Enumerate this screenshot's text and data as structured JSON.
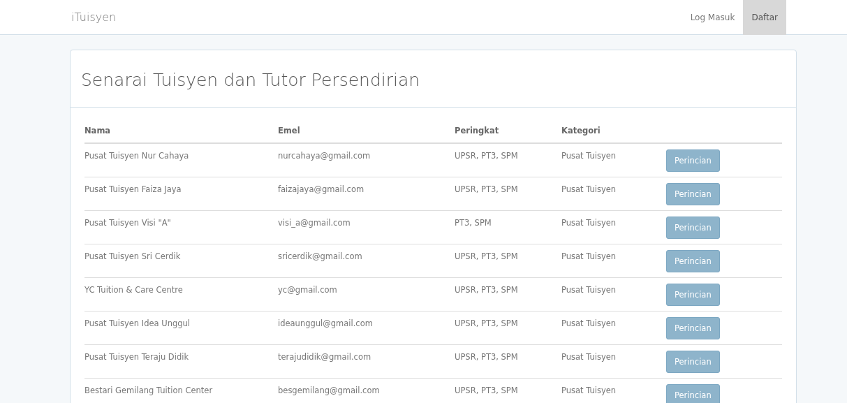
{
  "navbar": {
    "brand": "iTuisyen",
    "links": [
      {
        "label": "Log Masuk",
        "selected": false
      },
      {
        "label": "Daftar",
        "selected": true
      }
    ]
  },
  "panel": {
    "title": "Senarai Tuisyen dan Tutor Persendirian"
  },
  "table": {
    "columns": [
      "Nama",
      "Emel",
      "Peringkat",
      "Kategori"
    ],
    "rows": [
      {
        "nama": "Pusat Tuisyen Nur Cahaya",
        "emel": "nurcahaya@gmail.com",
        "peringkat": "UPSR, PT3, SPM",
        "kategori": "Pusat Tuisyen",
        "action": "Perincian"
      },
      {
        "nama": "Pusat Tuisyen Faiza Jaya",
        "emel": "faizajaya@gmail.com",
        "peringkat": "UPSR, PT3, SPM",
        "kategori": "Pusat Tuisyen",
        "action": "Perincian"
      },
      {
        "nama": "Pusat Tuisyen Visi \"A\"",
        "emel": "visi_a@gmail.com",
        "peringkat": "PT3, SPM",
        "kategori": "Pusat Tuisyen",
        "action": "Perincian"
      },
      {
        "nama": "Pusat Tuisyen Sri Cerdik",
        "emel": "sricerdik@gmail.com",
        "peringkat": "UPSR, PT3, SPM",
        "kategori": "Pusat Tuisyen",
        "action": "Perincian"
      },
      {
        "nama": "YC Tuition & Care Centre",
        "emel": "yc@gmail.com",
        "peringkat": "UPSR, PT3, SPM",
        "kategori": "Pusat Tuisyen",
        "action": "Perincian"
      },
      {
        "nama": "Pusat Tuisyen Idea Unggul",
        "emel": "ideaunggul@gmail.com",
        "peringkat": "UPSR, PT3, SPM",
        "kategori": "Pusat Tuisyen",
        "action": "Perincian"
      },
      {
        "nama": "Pusat Tuisyen Teraju Didik",
        "emel": "terajudidik@gmail.com",
        "peringkat": "UPSR, PT3, SPM",
        "kategori": "Pusat Tuisyen",
        "action": "Perincian"
      },
      {
        "nama": "Bestari Gemilang Tuition Center",
        "emel": "besgemilang@gmail.com",
        "peringkat": "UPSR, PT3, SPM",
        "kategori": "Pusat Tuisyen",
        "action": "Perincian"
      }
    ]
  }
}
